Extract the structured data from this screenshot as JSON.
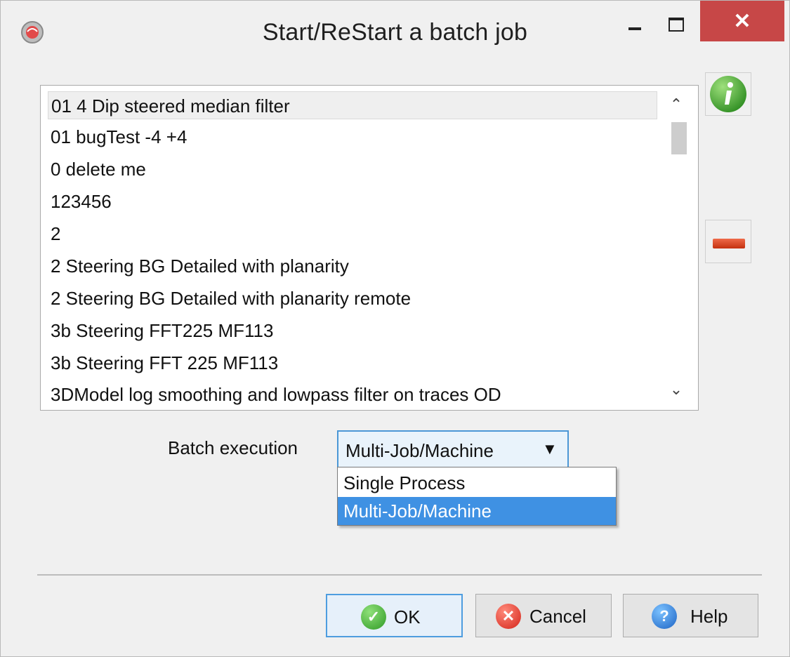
{
  "window": {
    "title": "Start/ReStart a batch job",
    "controls": {
      "minimize": "minimize-icon",
      "maximize": "maximize-icon",
      "close": "✕"
    }
  },
  "jobs_list": {
    "items": [
      "01 4 Dip steered median filter",
      "01 bugTest -4 +4",
      "0 delete me",
      "123456",
      "2",
      "2 Steering BG Detailed with planarity",
      "2 Steering BG Detailed with planarity remote",
      "3b Steering FFT225 MF113",
      "3b Steering FFT 225  MF113",
      "3DModel log smoothing and lowpass filter on traces  OD"
    ],
    "selected_index": 0,
    "scroll_up_glyph": "⌃",
    "scroll_down_glyph": "⌄"
  },
  "side_buttons": {
    "info_icon": "info-icon",
    "remove_icon": "remove-icon"
  },
  "batch_execution": {
    "label": "Batch execution",
    "selected": "Multi-Job/Machine",
    "caret": "▼",
    "options": [
      "Single Process",
      "Multi-Job/Machine"
    ]
  },
  "buttons": {
    "ok": "OK",
    "cancel": "Cancel",
    "help": "Help",
    "help_glyph": "?"
  },
  "colors": {
    "close_button": "#c74747",
    "highlight": "#3f91e3",
    "focus_border": "#4b97d6"
  }
}
